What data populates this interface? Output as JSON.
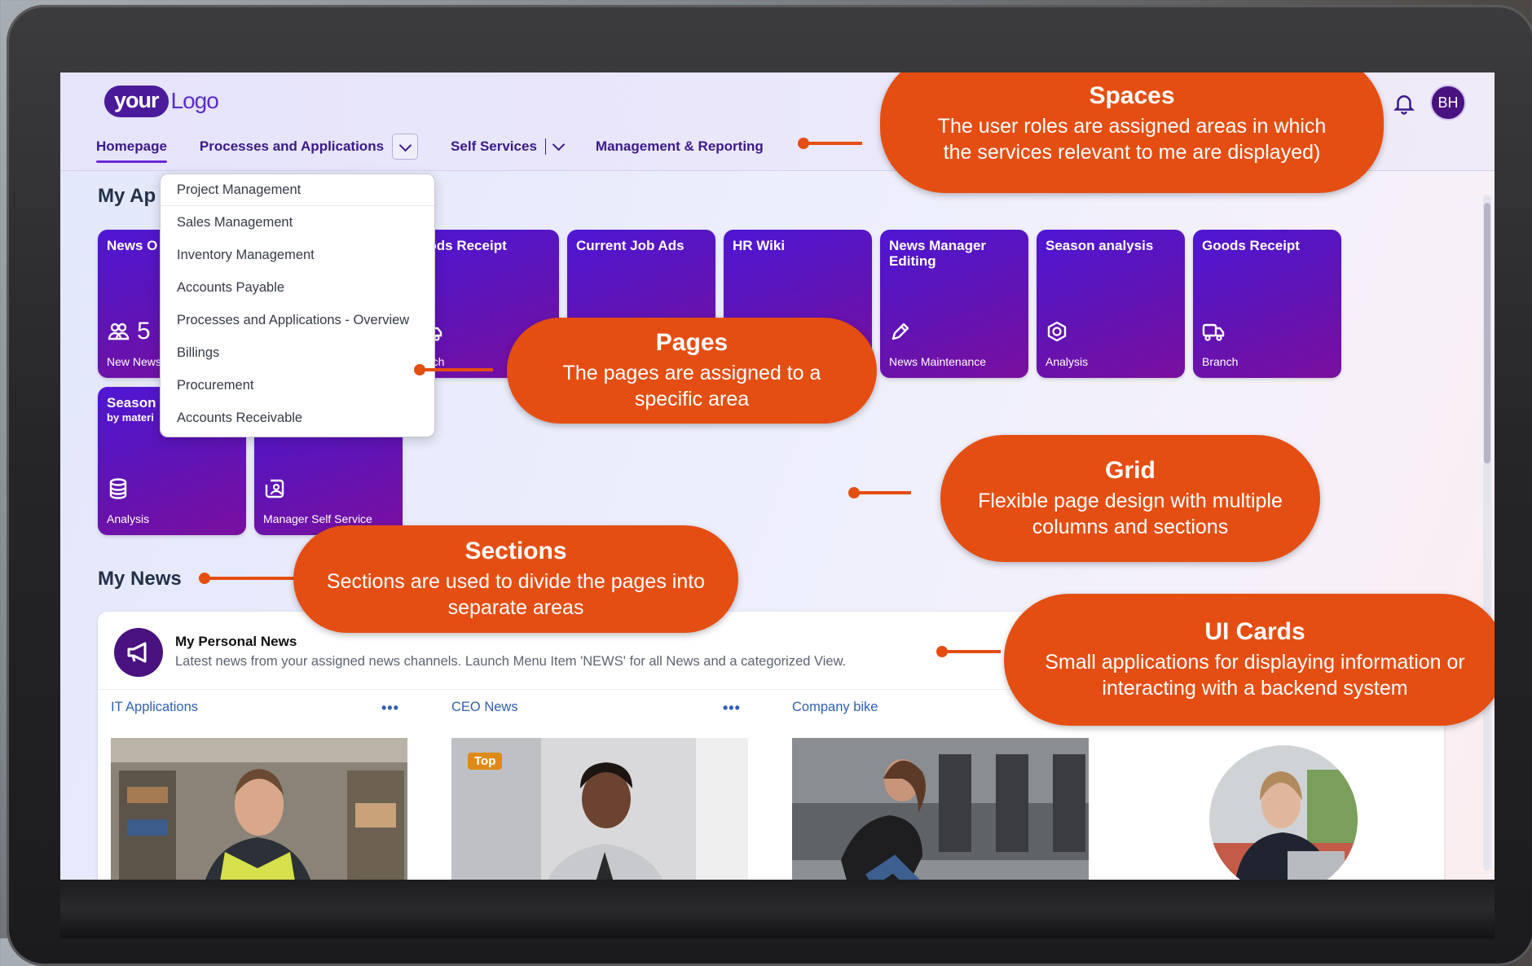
{
  "shell": {
    "logo_badge": "your",
    "logo_text": "Logo",
    "avatar_initials": "BH",
    "nav": {
      "homepage": "Homepage",
      "processes": "Processes and Applications",
      "self_services": "Self Services",
      "management": "Management & Reporting"
    }
  },
  "dropdown": {
    "items": [
      "Project Management",
      "Sales Management",
      "Inventory Management",
      "Accounts Payable",
      "Processes and Applications - Overview",
      "Billings",
      "Procurement",
      "Accounts Receivable"
    ]
  },
  "my_apps": {
    "title": "My Ap",
    "tiles": [
      {
        "title": "News O",
        "kpi": "5",
        "foot": "New News",
        "icon": "group-icon"
      },
      {
        "title": "oods Receipt",
        "foot": "anch",
        "icon": "truck-icon"
      },
      {
        "title": "Current Job Ads",
        "foot": "",
        "icon": ""
      },
      {
        "title": "HR Wiki",
        "foot": "",
        "icon": ""
      },
      {
        "title": "News Manager Editing",
        "foot": "News Maintenance",
        "icon": "edit-icon"
      },
      {
        "title": "Season analysis",
        "foot": "Analysis",
        "icon": "analysis-icon"
      },
      {
        "title": "Goods Receipt",
        "foot": "Branch",
        "icon": "truck-icon"
      },
      {
        "title": "Season",
        "subtitle": "by materi",
        "foot": "Analysis",
        "icon": "database-icon"
      },
      {
        "title": "",
        "foot": "Manager Self Service",
        "icon": "badge-icon"
      }
    ]
  },
  "my_news": {
    "title": "My News",
    "card_title": "My Personal News",
    "card_subtitle": "Latest news from your assigned news channels. Launch Menu Item 'NEWS' for all News and a categorized View.",
    "channels": [
      "IT Applications",
      "CEO News",
      "Company bike"
    ],
    "more": "•••",
    "top_badge": "Top"
  },
  "callouts": {
    "spaces": {
      "title": "Spaces",
      "desc": "The user roles are assigned areas in which the services relevant to me are displayed)"
    },
    "pages": {
      "title": "Pages",
      "desc": "The pages are assigned to a specific area"
    },
    "grid": {
      "title": "Grid",
      "desc": "Flexible page design with multiple columns and sections"
    },
    "sections": {
      "title": "Sections",
      "desc": "Sections are used to divide the pages into separate areas"
    },
    "cards": {
      "title": "UI Cards",
      "desc": "Small applications for displaying information or interacting with a backend system"
    }
  },
  "colors": {
    "accent": "#e54e12",
    "tile_start": "#4f16d4",
    "tile_end": "#7a0f9e",
    "brand": "#4a1280"
  }
}
